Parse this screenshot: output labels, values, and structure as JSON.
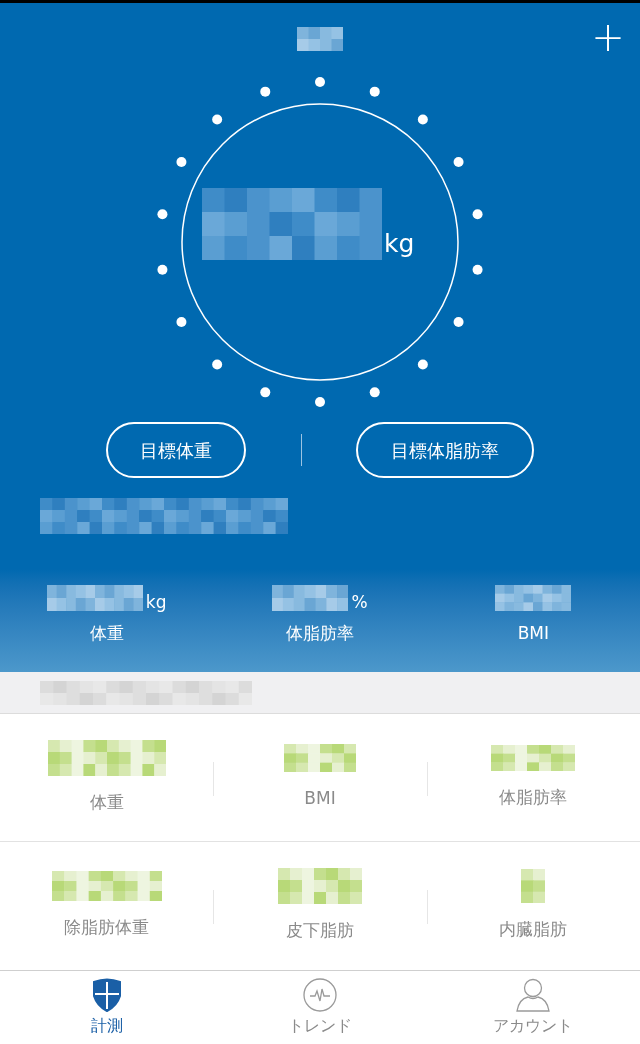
{
  "header": {
    "unit": "kg",
    "add_button": "+"
  },
  "goal_buttons": [
    "目標体重",
    "目標体脂肪率"
  ],
  "summary": [
    {
      "unit": "kg",
      "label": "体重"
    },
    {
      "unit": "%",
      "label": "体脂肪率"
    },
    {
      "label": "BMI"
    }
  ],
  "metrics": [
    {
      "label": "体重"
    },
    {
      "label": "BMI"
    },
    {
      "label": "体脂肪率"
    },
    {
      "label": "除脂肪体重"
    },
    {
      "label": "皮下脂肪"
    },
    {
      "label": "内臓脂肪"
    }
  ],
  "nav": [
    {
      "label": "計測",
      "selected": true,
      "kind": "shield"
    },
    {
      "label": "トレンド",
      "selected": false,
      "kind": "pulse"
    },
    {
      "label": "アカウント",
      "selected": false,
      "kind": "person"
    }
  ]
}
